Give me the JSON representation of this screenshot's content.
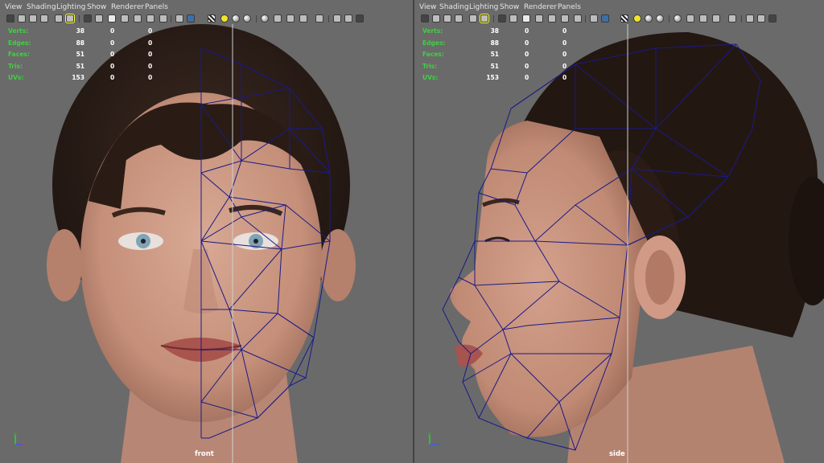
{
  "menu": [
    "View",
    "Shading",
    "Lighting",
    "Show",
    "Renderer",
    "Panels"
  ],
  "hud": {
    "rows": [
      {
        "label": "Verts:",
        "values": [
          "38",
          "0",
          "0"
        ]
      },
      {
        "label": "Edges:",
        "values": [
          "88",
          "0",
          "0"
        ]
      },
      {
        "label": "Faces:",
        "values": [
          "51",
          "0",
          "0"
        ]
      },
      {
        "label": "Tris:",
        "values": [
          "51",
          "0",
          "0"
        ]
      },
      {
        "label": "UVs:",
        "values": [
          "153",
          "0",
          "0"
        ]
      }
    ]
  },
  "viewports": {
    "left": {
      "camera_label": "front"
    },
    "right": {
      "camera_label": "side"
    }
  },
  "axis": {
    "x": "x",
    "y": "y",
    "z": "z"
  },
  "colors": {
    "viewport_bg": "#6a6a6a",
    "hud_label": "#3fd13f",
    "wireframe": "#1a1a88",
    "camera_line": "#d0d0d0"
  },
  "toolbar_icons": [
    "camera-select-icon",
    "camera-attributes-icon",
    "bookmark-icon",
    "image-plane-icon",
    "grease-pencil-icon",
    "resolution-gate-icon",
    "wireframe-icon",
    "smooth-shade-icon",
    "textured-icon",
    "lights-icon",
    "shadows-icon",
    "xray-icon",
    "isolate-select-icon",
    "default-light-icon",
    "all-lights-icon",
    "ambient-occlusion-icon",
    "motion-blur-icon",
    "antialias-icon",
    "depth-of-field-icon",
    "isolate-icon",
    "frame-all-icon",
    "frame-selected-icon",
    "render-icon"
  ]
}
